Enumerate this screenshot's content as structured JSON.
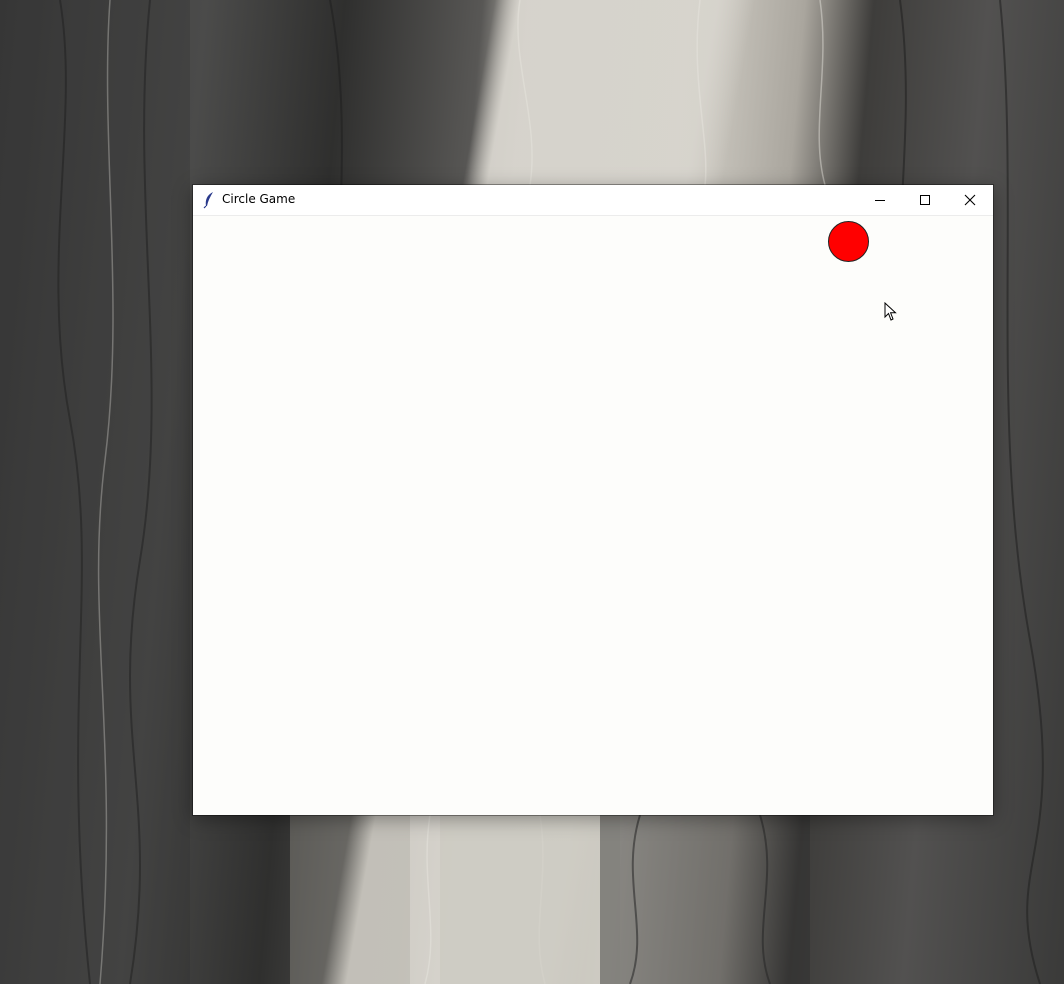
{
  "window": {
    "title": "Circle Game",
    "controls": {
      "minimize_icon": "minimize-icon",
      "maximize_icon": "maximize-icon",
      "close_icon": "close-icon"
    },
    "app_icon": "feather-icon"
  },
  "game": {
    "circle_color": "#ff0000",
    "canvas_background": "#fdfdfb"
  },
  "cursor_icon": "arrow-cursor-icon"
}
